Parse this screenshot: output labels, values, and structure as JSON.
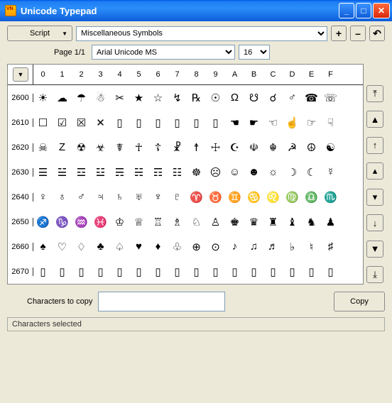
{
  "window": {
    "title": "Unicode Typepad"
  },
  "toolbar": {
    "script_label": "Script",
    "category": "Miscellaneous Symbols",
    "plus": "+",
    "minus": "–",
    "undo": "↶",
    "page_label": "Page 1/1",
    "font": "Arial Unicode MS",
    "size": "16"
  },
  "grid": {
    "cols": [
      "0",
      "1",
      "2",
      "3",
      "4",
      "5",
      "6",
      "7",
      "8",
      "9",
      "A",
      "B",
      "C",
      "D",
      "E",
      "F"
    ],
    "rows": [
      {
        "h": "2600",
        "c": [
          "☀",
          "☁",
          "☂",
          "☃",
          "✂",
          "★",
          "☆",
          "↯",
          "℞",
          "☉",
          "Ω",
          "☋",
          "☌",
          "♂",
          "☎",
          "☏"
        ]
      },
      {
        "h": "2610",
        "c": [
          "☐",
          "☑",
          "☒",
          "✕",
          "▯",
          "▯",
          "▯",
          "▯",
          "▯",
          "▯",
          "☚",
          "☛",
          "☜",
          "☝",
          "☞",
          "☟"
        ]
      },
      {
        "h": "2620",
        "c": [
          "☠",
          "Z",
          "☢",
          "☣",
          "☤",
          "☥",
          "☦",
          "☧",
          "☨",
          "☩",
          "☪",
          "☫",
          "☬",
          "☭",
          "☮",
          "☯"
        ]
      },
      {
        "h": "2630",
        "c": [
          "☰",
          "☱",
          "☲",
          "☳",
          "☴",
          "☵",
          "☶",
          "☷",
          "☸",
          "☹",
          "☺",
          "☻",
          "☼",
          "☽",
          "☾",
          "☿"
        ]
      },
      {
        "h": "2640",
        "c": [
          "♀",
          "♁",
          "♂",
          "♃",
          "♄",
          "♅",
          "♆",
          "♇",
          "♈",
          "♉",
          "♊",
          "♋",
          "♌",
          "♍",
          "♎",
          "♏"
        ]
      },
      {
        "h": "2650",
        "c": [
          "♐",
          "♑",
          "♒",
          "♓",
          "♔",
          "♕",
          "♖",
          "♗",
          "♘",
          "♙",
          "♚",
          "♛",
          "♜",
          "♝",
          "♞",
          "♟"
        ]
      },
      {
        "h": "2660",
        "c": [
          "♠",
          "♡",
          "♢",
          "♣",
          "♤",
          "♥",
          "♦",
          "♧",
          "⊕",
          "⊙",
          "♪",
          "♫",
          "♬",
          "♭",
          "♮",
          "♯"
        ]
      },
      {
        "h": "2670",
        "c": [
          "▯",
          "▯",
          "▯",
          "▯",
          "▯",
          "▯",
          "▯",
          "▯",
          "▯",
          "▯",
          "▯",
          "▯",
          "▯",
          "▯",
          "▯",
          "▯"
        ]
      }
    ]
  },
  "nav": {
    "top": "⤒",
    "pgup": "▲",
    "up": "↑",
    "sup": "▴",
    "sdn": "▾",
    "dn": "↓",
    "pgdn": "▼",
    "bot": "⤓"
  },
  "copy": {
    "label": "Characters to copy",
    "button": "Copy"
  },
  "status": {
    "text": "Characters selected"
  }
}
